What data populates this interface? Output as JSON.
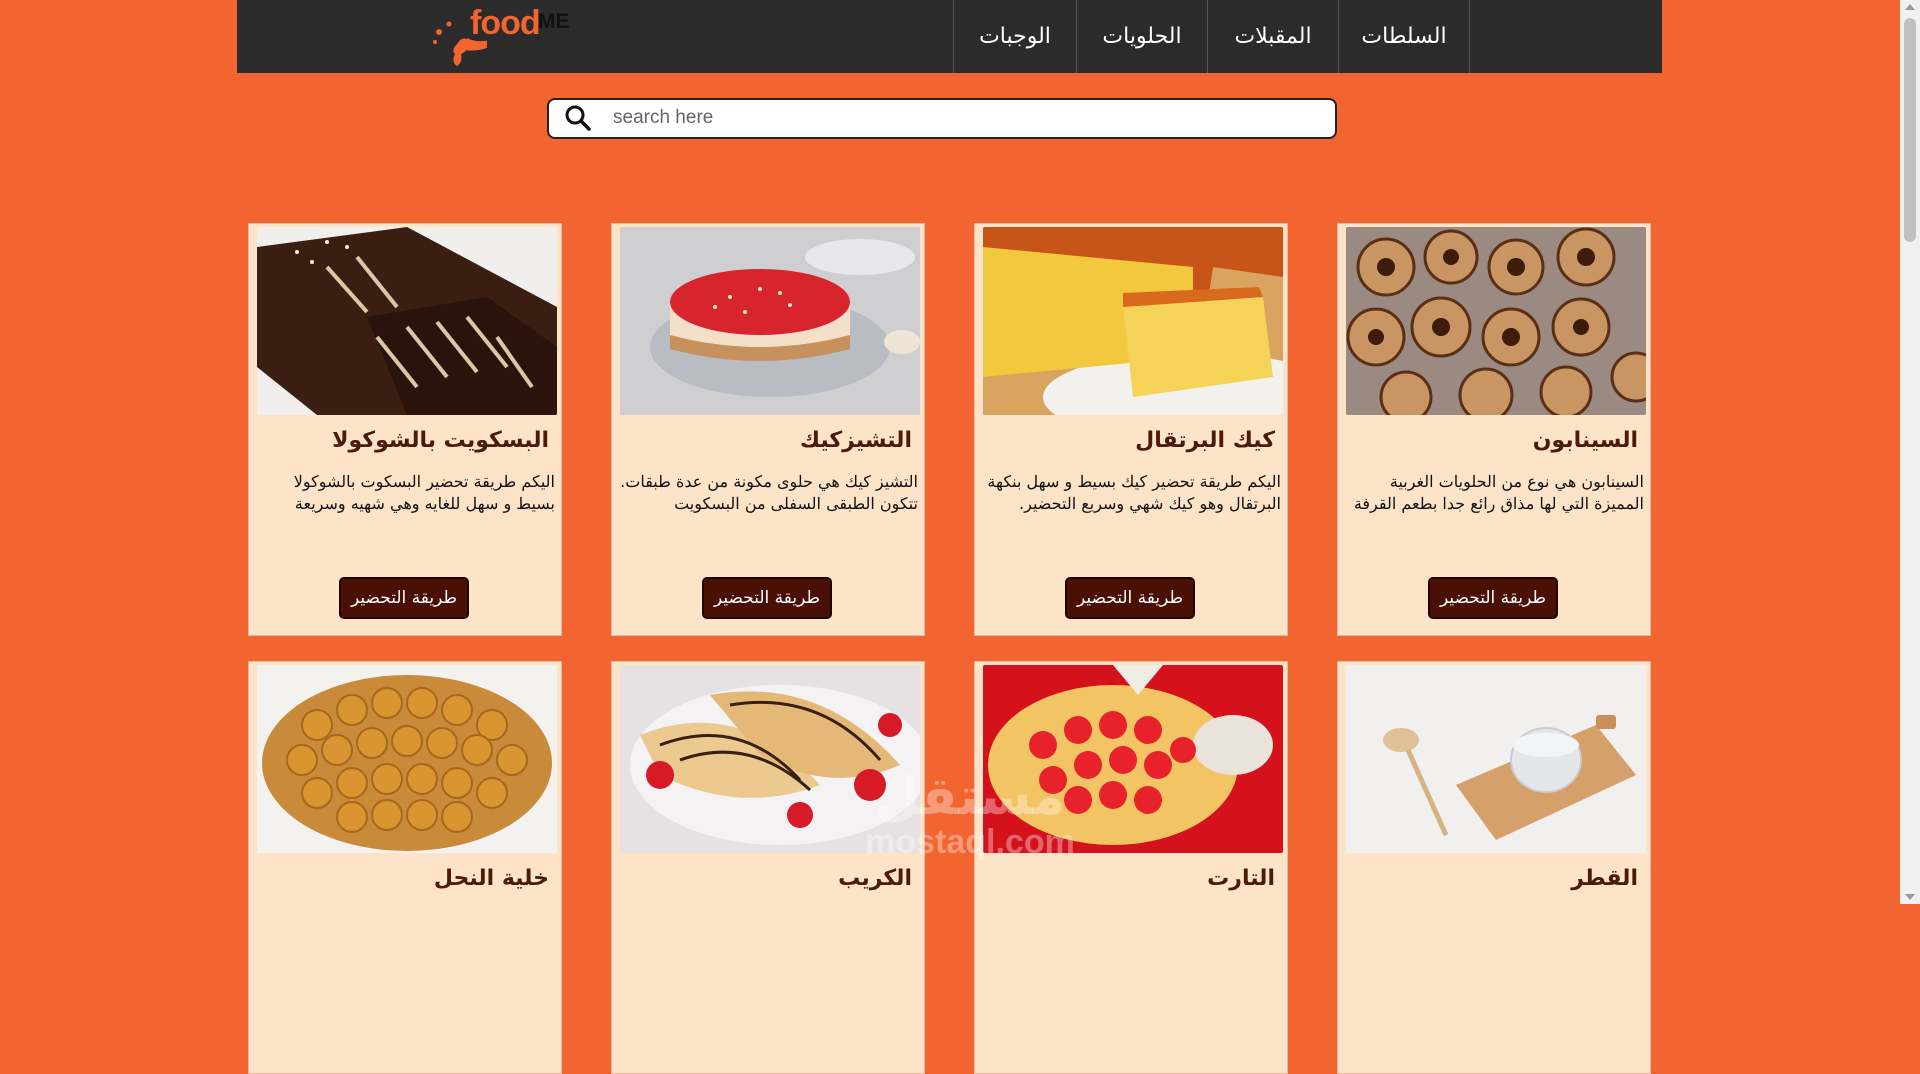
{
  "brand": {
    "name_part1": "food",
    "name_part2": "ME"
  },
  "nav": [
    {
      "label": "السلطات"
    },
    {
      "label": "المقبلات"
    },
    {
      "label": "الحلويات"
    },
    {
      "label": "الوجبات"
    }
  ],
  "search": {
    "placeholder": "search here",
    "value": ""
  },
  "cards": [
    {
      "title": "السينابون",
      "desc": "السينابون هي نوع من الحلويات الغربية المميزة التي لها مذاق رائع جدا بطعم القرفة اللذيذة،",
      "button": "طريقة التحضير",
      "image": "cinnamon-rolls"
    },
    {
      "title": "كيك البرتقال",
      "desc": "اليكم طريقة تحضير كيك بسيط و سهل بنكهة البرتقال وهو كيك شهي وسريع التحضير. اليكم",
      "button": "طريقة التحضير",
      "image": "orange-cake"
    },
    {
      "title": "التشيزكيك",
      "desc": "التشيز كيك هي حلوى مكونة من عدة طبقات. تتكون الطبقى السفلى من البسكويت والطبقة",
      "button": "طريقة التحضير",
      "image": "cheesecake"
    },
    {
      "title": "البسكويت بالشوكولا",
      "desc": "اليكم طريقة تحضير البسكوت بالشوكولا بسيط و سهل للغايه وهي شهيه وسريعة التحضير.",
      "button": "طريقة التحضير",
      "image": "chocolate-biscuit-cake"
    },
    {
      "title": "القطر",
      "desc": "",
      "button": "",
      "image": "syrup"
    },
    {
      "title": "التارت",
      "desc": "",
      "button": "",
      "image": "strawberry-tart"
    },
    {
      "title": "الكريب",
      "desc": "",
      "button": "",
      "image": "crepes"
    },
    {
      "title": "خلية النحل",
      "desc": "",
      "button": "",
      "image": "honeycomb-bread"
    }
  ],
  "watermark": {
    "ar": "مستقل",
    "en": "mostaql.com"
  },
  "colors": {
    "background": "#f26430",
    "navbar": "#2b2b2b",
    "card": "#fde3c7",
    "button": "#4a1005",
    "title": "#4a1a0c"
  }
}
